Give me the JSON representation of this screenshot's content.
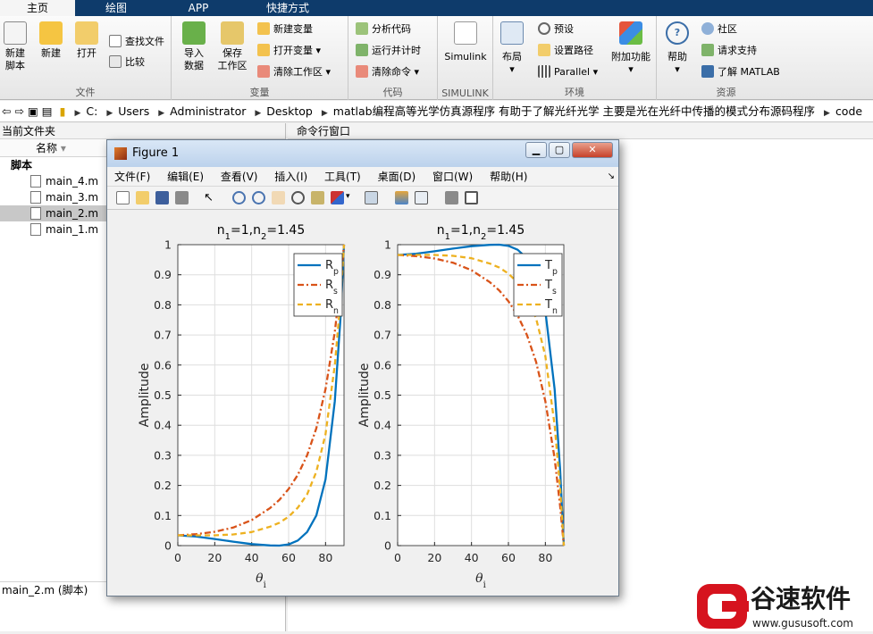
{
  "tabs": [
    "主页",
    "绘图",
    "APP",
    "快捷方式"
  ],
  "ribbon": {
    "file": {
      "label": "文件",
      "new_script": "新建\n脚本",
      "new": "新建",
      "open": "打开",
      "find_files": "查找文件",
      "compare": "比较"
    },
    "variable": {
      "label": "变量",
      "import": "导入\n数据",
      "save_ws": "保存\n工作区",
      "new_var": "新建变量",
      "open_var": "打开变量",
      "clear_ws": "清除工作区"
    },
    "code": {
      "label": "代码",
      "analyze": "分析代码",
      "run_time": "运行并计时",
      "clear_cmds": "清除命令"
    },
    "simulink": {
      "label": "SIMULINK",
      "btn": "Simulink"
    },
    "env": {
      "label": "环境",
      "layout": "布局",
      "prefs": "预设",
      "set_path": "设置路径",
      "parallel": "Parallel",
      "addons": "附加功能"
    },
    "res": {
      "label": "资源",
      "help": "帮助",
      "community": "社区",
      "support": "请求支持",
      "learn": "了解 MATLAB"
    }
  },
  "address": [
    "C:",
    "Users",
    "Administrator",
    "Desktop",
    "matlab编程高等光学仿真源程序 有助于了解光纤光学 主要是光在光纤中传播的模式分布源码程序",
    "code"
  ],
  "left": {
    "title": "当前文件夹",
    "col": "名称",
    "root": "脚本",
    "files": [
      "main_4.m",
      "main_3.m",
      "main_2.m",
      "main_1.m"
    ],
    "status": "main_2.m  (脚本)"
  },
  "cmd": {
    "title": "命令行窗口"
  },
  "figure": {
    "title": "Figure 1",
    "menus": [
      "文件(F)",
      "编辑(E)",
      "查看(V)",
      "插入(I)",
      "工具(T)",
      "桌面(D)",
      "窗口(W)",
      "帮助(H)"
    ]
  },
  "colors": {
    "blue": "#0072bd",
    "orange": "#d95319",
    "yellow": "#edb120"
  },
  "logo": {
    "brand": "谷速软件",
    "url": "www.gususoft.com"
  },
  "chart_data": [
    {
      "type": "line",
      "title": "n1=1,n2=1.45",
      "xlabel": "θi",
      "ylabel": "Amplitude",
      "xlim": [
        0,
        90
      ],
      "ylim": [
        0,
        1
      ],
      "xticks": [
        0,
        20,
        40,
        60,
        80
      ],
      "yticks": [
        0,
        0.1,
        0.2,
        0.3,
        0.4,
        0.5,
        0.6,
        0.7,
        0.8,
        0.9,
        1
      ],
      "grid": true,
      "legend_position": "top-right",
      "x": [
        0,
        10,
        20,
        30,
        40,
        50,
        55,
        60,
        65,
        70,
        75,
        80,
        85,
        88,
        90
      ],
      "series": [
        {
          "name": "Rp",
          "values": [
            0.034,
            0.03,
            0.022,
            0.013,
            0.005,
            0.0005,
            0.0,
            0.004,
            0.017,
            0.045,
            0.1,
            0.22,
            0.48,
            0.75,
            1.0
          ]
        },
        {
          "name": "Rs",
          "values": [
            0.034,
            0.038,
            0.046,
            0.06,
            0.085,
            0.125,
            0.152,
            0.188,
            0.235,
            0.3,
            0.39,
            0.52,
            0.71,
            0.87,
            1.0
          ]
        },
        {
          "name": "Rn",
          "values": [
            0.034,
            0.034,
            0.034,
            0.037,
            0.045,
            0.063,
            0.076,
            0.096,
            0.126,
            0.17,
            0.245,
            0.37,
            0.6,
            0.81,
            1.0
          ]
        }
      ]
    },
    {
      "type": "line",
      "title": "n1=1,n2=1.45",
      "xlabel": "θi",
      "ylabel": "Amplitude",
      "xlim": [
        0,
        90
      ],
      "ylim": [
        0,
        1
      ],
      "xticks": [
        0,
        20,
        40,
        60,
        80
      ],
      "yticks": [
        0,
        0.1,
        0.2,
        0.3,
        0.4,
        0.5,
        0.6,
        0.7,
        0.8,
        0.9,
        1
      ],
      "grid": true,
      "legend_position": "top-right",
      "x": [
        0,
        10,
        20,
        30,
        40,
        50,
        55,
        60,
        65,
        70,
        75,
        80,
        85,
        88,
        90
      ],
      "series": [
        {
          "name": "Tp",
          "values": [
            0.966,
            0.97,
            0.978,
            0.987,
            0.995,
            0.9995,
            1.0,
            0.996,
            0.983,
            0.955,
            0.9,
            0.78,
            0.52,
            0.25,
            0.0
          ]
        },
        {
          "name": "Ts",
          "values": [
            0.966,
            0.962,
            0.954,
            0.94,
            0.915,
            0.875,
            0.848,
            0.812,
            0.765,
            0.7,
            0.61,
            0.48,
            0.29,
            0.13,
            0.0
          ]
        },
        {
          "name": "Tn",
          "values": [
            0.966,
            0.966,
            0.966,
            0.963,
            0.955,
            0.937,
            0.924,
            0.904,
            0.874,
            0.83,
            0.755,
            0.63,
            0.4,
            0.19,
            0.0
          ]
        }
      ]
    }
  ]
}
